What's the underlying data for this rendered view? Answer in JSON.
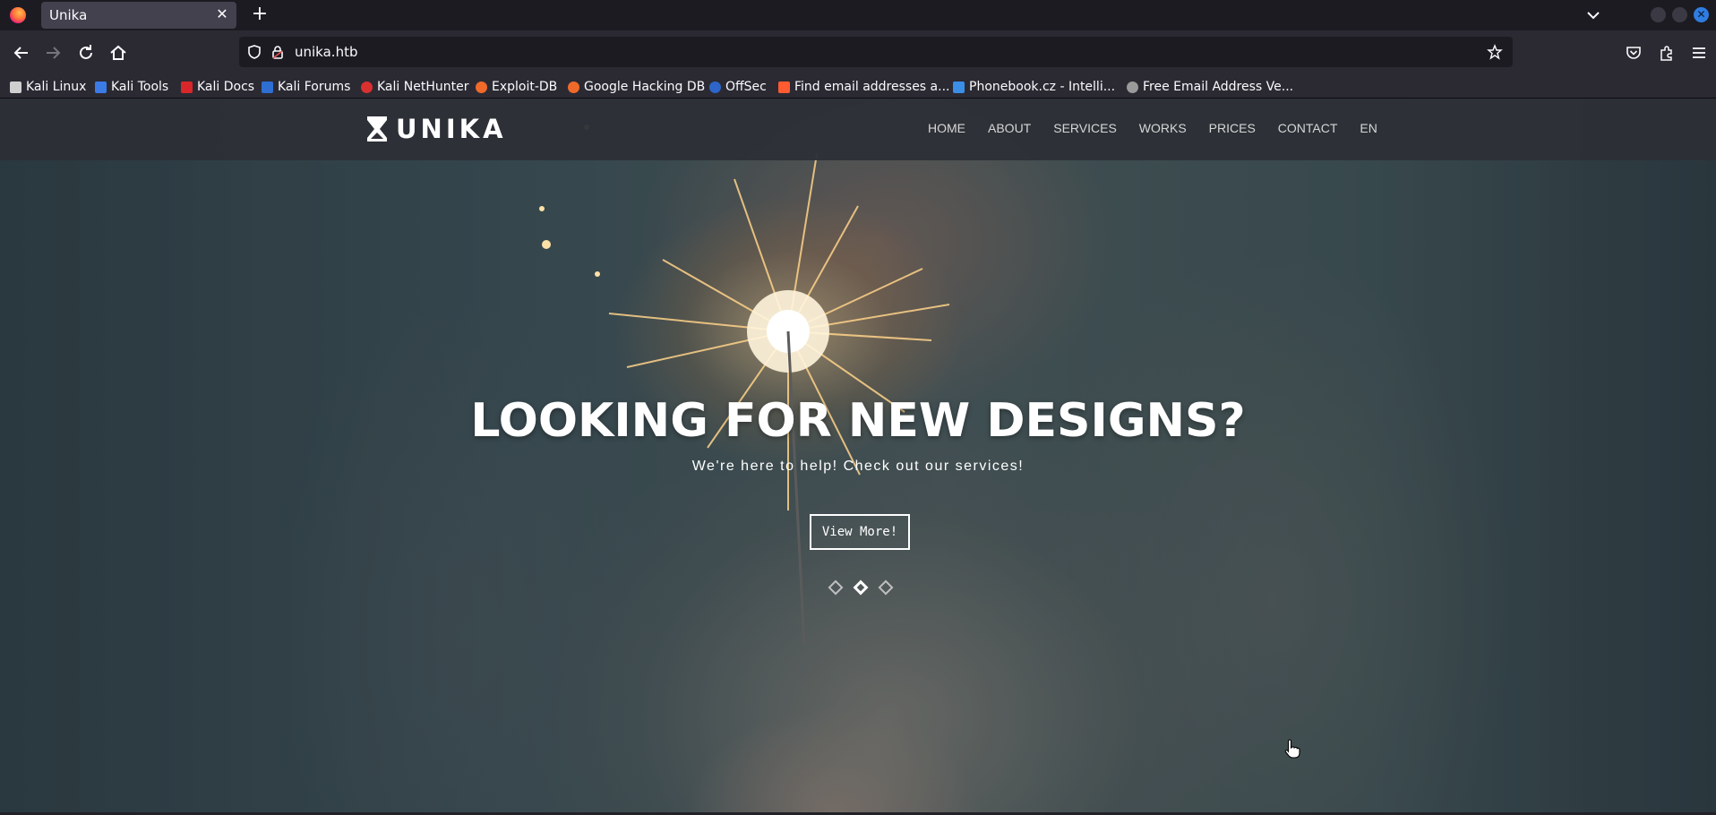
{
  "browser": {
    "tab_title": "Unika",
    "url": "unika.htb",
    "accent_close": "#2f7de1",
    "bookmarks": [
      {
        "label": "Kali Linux",
        "icon": "kali-dragon-icon",
        "color": "#e8e8e8"
      },
      {
        "label": "Kali Tools",
        "icon": "kali-tools-icon",
        "color": "#3b7be8"
      },
      {
        "label": "Kali Docs",
        "icon": "kali-docs-icon",
        "color": "#d9262b"
      },
      {
        "label": "Kali Forums",
        "icon": "kali-forums-icon",
        "color": "#2e6fd1"
      },
      {
        "label": "Kali NetHunter",
        "icon": "nethunter-icon",
        "color": "#d93030"
      },
      {
        "label": "Exploit-DB",
        "icon": "exploit-db-icon",
        "color": "#ef6a2a"
      },
      {
        "label": "Google Hacking DB",
        "icon": "ghdb-icon",
        "color": "#ef6a2a"
      },
      {
        "label": "OffSec",
        "icon": "offsec-icon",
        "color": "#2d66c8"
      },
      {
        "label": "Find email addresses a...",
        "icon": "hunter-icon",
        "color": "#ff5b30"
      },
      {
        "label": "Phonebook.cz - Intelli...",
        "icon": "phonebook-icon",
        "color": "#3a8ee6"
      },
      {
        "label": "Free Email Address Ve...",
        "icon": "email-verifier-icon",
        "color": "#9a9a9a"
      }
    ]
  },
  "site": {
    "logo_text": "UNIKA",
    "menu": [
      "HOME",
      "ABOUT",
      "SERVICES",
      "WORKS",
      "PRICES",
      "CONTACT",
      "EN"
    ],
    "hero": {
      "title": "LOOKING FOR NEW DESIGNS?",
      "subtitle": "We're here to help! Check out our services!",
      "button": "View More!",
      "slide_count": 3,
      "active_slide": 2
    }
  }
}
